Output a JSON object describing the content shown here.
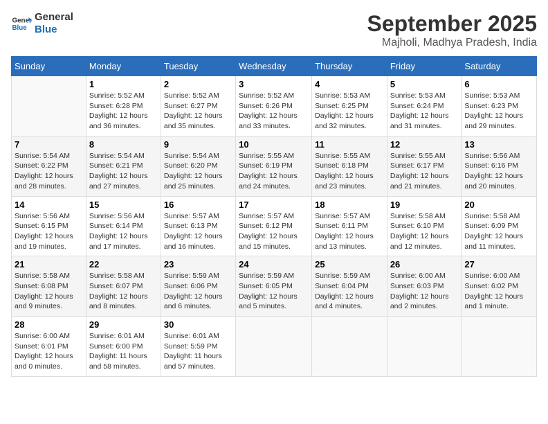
{
  "logo": {
    "line1": "General",
    "line2": "Blue"
  },
  "title": "September 2025",
  "subtitle": "Majholi, Madhya Pradesh, India",
  "weekdays": [
    "Sunday",
    "Monday",
    "Tuesday",
    "Wednesday",
    "Thursday",
    "Friday",
    "Saturday"
  ],
  "weeks": [
    [
      {
        "day": "",
        "info": ""
      },
      {
        "day": "1",
        "info": "Sunrise: 5:52 AM\nSunset: 6:28 PM\nDaylight: 12 hours\nand 36 minutes."
      },
      {
        "day": "2",
        "info": "Sunrise: 5:52 AM\nSunset: 6:27 PM\nDaylight: 12 hours\nand 35 minutes."
      },
      {
        "day": "3",
        "info": "Sunrise: 5:52 AM\nSunset: 6:26 PM\nDaylight: 12 hours\nand 33 minutes."
      },
      {
        "day": "4",
        "info": "Sunrise: 5:53 AM\nSunset: 6:25 PM\nDaylight: 12 hours\nand 32 minutes."
      },
      {
        "day": "5",
        "info": "Sunrise: 5:53 AM\nSunset: 6:24 PM\nDaylight: 12 hours\nand 31 minutes."
      },
      {
        "day": "6",
        "info": "Sunrise: 5:53 AM\nSunset: 6:23 PM\nDaylight: 12 hours\nand 29 minutes."
      }
    ],
    [
      {
        "day": "7",
        "info": "Sunrise: 5:54 AM\nSunset: 6:22 PM\nDaylight: 12 hours\nand 28 minutes."
      },
      {
        "day": "8",
        "info": "Sunrise: 5:54 AM\nSunset: 6:21 PM\nDaylight: 12 hours\nand 27 minutes."
      },
      {
        "day": "9",
        "info": "Sunrise: 5:54 AM\nSunset: 6:20 PM\nDaylight: 12 hours\nand 25 minutes."
      },
      {
        "day": "10",
        "info": "Sunrise: 5:55 AM\nSunset: 6:19 PM\nDaylight: 12 hours\nand 24 minutes."
      },
      {
        "day": "11",
        "info": "Sunrise: 5:55 AM\nSunset: 6:18 PM\nDaylight: 12 hours\nand 23 minutes."
      },
      {
        "day": "12",
        "info": "Sunrise: 5:55 AM\nSunset: 6:17 PM\nDaylight: 12 hours\nand 21 minutes."
      },
      {
        "day": "13",
        "info": "Sunrise: 5:56 AM\nSunset: 6:16 PM\nDaylight: 12 hours\nand 20 minutes."
      }
    ],
    [
      {
        "day": "14",
        "info": "Sunrise: 5:56 AM\nSunset: 6:15 PM\nDaylight: 12 hours\nand 19 minutes."
      },
      {
        "day": "15",
        "info": "Sunrise: 5:56 AM\nSunset: 6:14 PM\nDaylight: 12 hours\nand 17 minutes."
      },
      {
        "day": "16",
        "info": "Sunrise: 5:57 AM\nSunset: 6:13 PM\nDaylight: 12 hours\nand 16 minutes."
      },
      {
        "day": "17",
        "info": "Sunrise: 5:57 AM\nSunset: 6:12 PM\nDaylight: 12 hours\nand 15 minutes."
      },
      {
        "day": "18",
        "info": "Sunrise: 5:57 AM\nSunset: 6:11 PM\nDaylight: 12 hours\nand 13 minutes."
      },
      {
        "day": "19",
        "info": "Sunrise: 5:58 AM\nSunset: 6:10 PM\nDaylight: 12 hours\nand 12 minutes."
      },
      {
        "day": "20",
        "info": "Sunrise: 5:58 AM\nSunset: 6:09 PM\nDaylight: 12 hours\nand 11 minutes."
      }
    ],
    [
      {
        "day": "21",
        "info": "Sunrise: 5:58 AM\nSunset: 6:08 PM\nDaylight: 12 hours\nand 9 minutes."
      },
      {
        "day": "22",
        "info": "Sunrise: 5:58 AM\nSunset: 6:07 PM\nDaylight: 12 hours\nand 8 minutes."
      },
      {
        "day": "23",
        "info": "Sunrise: 5:59 AM\nSunset: 6:06 PM\nDaylight: 12 hours\nand 6 minutes."
      },
      {
        "day": "24",
        "info": "Sunrise: 5:59 AM\nSunset: 6:05 PM\nDaylight: 12 hours\nand 5 minutes."
      },
      {
        "day": "25",
        "info": "Sunrise: 5:59 AM\nSunset: 6:04 PM\nDaylight: 12 hours\nand 4 minutes."
      },
      {
        "day": "26",
        "info": "Sunrise: 6:00 AM\nSunset: 6:03 PM\nDaylight: 12 hours\nand 2 minutes."
      },
      {
        "day": "27",
        "info": "Sunrise: 6:00 AM\nSunset: 6:02 PM\nDaylight: 12 hours\nand 1 minute."
      }
    ],
    [
      {
        "day": "28",
        "info": "Sunrise: 6:00 AM\nSunset: 6:01 PM\nDaylight: 12 hours\nand 0 minutes."
      },
      {
        "day": "29",
        "info": "Sunrise: 6:01 AM\nSunset: 6:00 PM\nDaylight: 11 hours\nand 58 minutes."
      },
      {
        "day": "30",
        "info": "Sunrise: 6:01 AM\nSunset: 5:59 PM\nDaylight: 11 hours\nand 57 minutes."
      },
      {
        "day": "",
        "info": ""
      },
      {
        "day": "",
        "info": ""
      },
      {
        "day": "",
        "info": ""
      },
      {
        "day": "",
        "info": ""
      }
    ]
  ]
}
